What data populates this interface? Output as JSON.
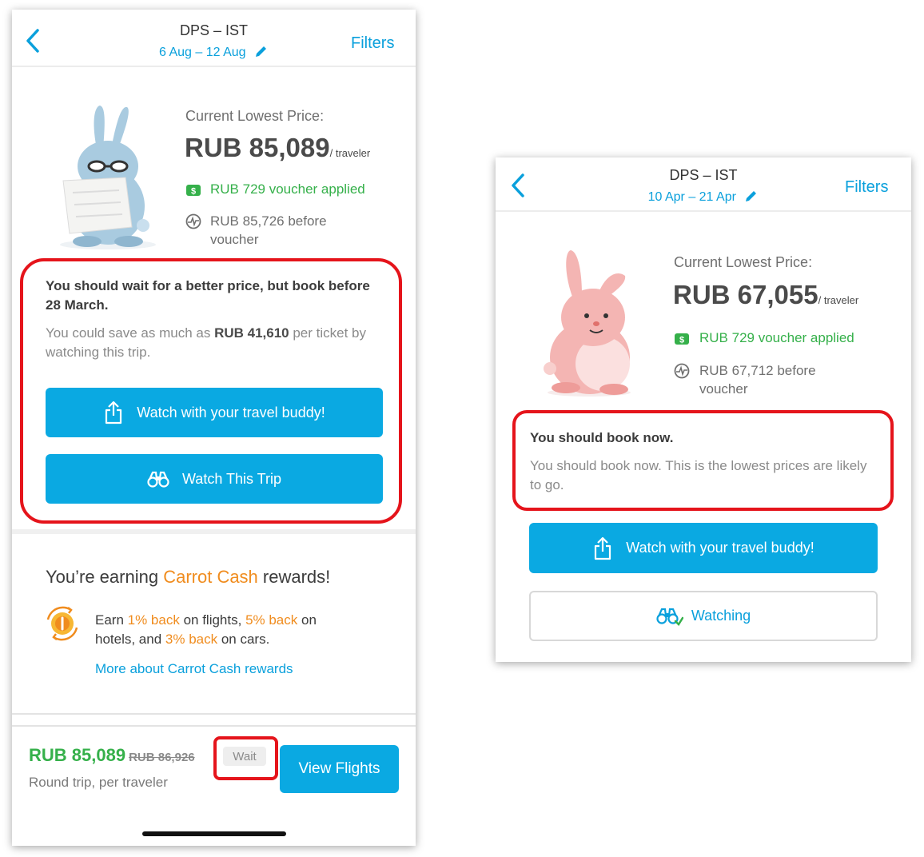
{
  "screens": [
    {
      "route": "DPS – IST",
      "dates": "6 Aug – 12 Aug",
      "filters_label": "Filters",
      "lowest_label": "Current Lowest Price:",
      "price": "RUB 85,089",
      "per_traveler": "/ traveler",
      "voucher_text": "RUB 729 voucher applied",
      "before_voucher": "RUB 85,726 before voucher",
      "advice_title": "You should wait for a better price, but book before 28 March.",
      "advice_text_pre": "You could save as much as ",
      "advice_amount": "RUB 41,610",
      "advice_text_post": " per ticket by watching this trip.",
      "buddy_button": "Watch with your travel buddy!",
      "watch_button": "Watch This Trip",
      "rewards": {
        "title_pre": "You’re earning ",
        "title_brand": "Carrot Cash",
        "title_post": " rewards!",
        "earn_1": "Earn ",
        "pct_flights": "1% back",
        "earn_2": " on flights, ",
        "pct_hotels": "5% back",
        "earn_3": " on hotels, and ",
        "pct_cars": "3% back",
        "earn_4": " on cars.",
        "more_link": "More about Carrot Cash rewards"
      },
      "footer": {
        "price": "RUB 85,089",
        "old_price": "RUB 86,926",
        "subtitle": "Round trip, per traveler",
        "badge": "Wait",
        "view_button": "View Flights"
      },
      "mascot_color": "#a9cbe0"
    },
    {
      "route": "DPS – IST",
      "dates": "10 Apr – 21 Apr",
      "filters_label": "Filters",
      "lowest_label": "Current Lowest Price:",
      "price": "RUB 67,055",
      "per_traveler": "/ traveler",
      "voucher_text": "RUB 729 voucher applied",
      "before_voucher": "RUB 67,712 before voucher",
      "advice_title": "You should book now.",
      "advice_text": "You should book now. This is the lowest prices are likely to go.",
      "buddy_button": "Watch with your travel buddy!",
      "watching_button": "Watching",
      "mascot_color": "#f4b5b3"
    }
  ],
  "colors": {
    "accent_blue": "#0aa9e2",
    "green": "#35b04a",
    "orange": "#f08c1e",
    "highlight_red": "#e5141b"
  }
}
